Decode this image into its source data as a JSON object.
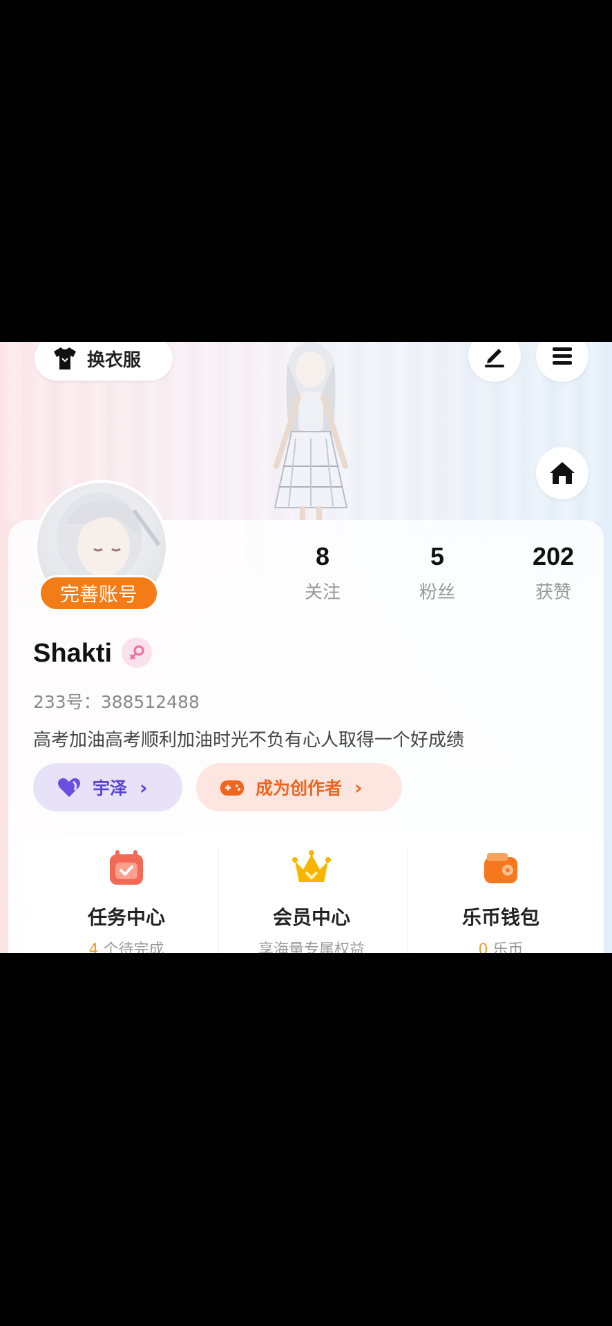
{
  "header": {
    "outfit_label": "换衣服",
    "icons": [
      "tshirt-icon",
      "edit-icon",
      "menu-icon",
      "home-icon"
    ]
  },
  "profile": {
    "complete_label": "完善账号",
    "username": "Shakti",
    "uid_label": "233号：",
    "uid": "388512488",
    "bio": "高考加油高考顺利加油时光不负有心人取得一个好成绩"
  },
  "stats": [
    {
      "value": "8",
      "label": "关注"
    },
    {
      "value": "5",
      "label": "粉丝"
    },
    {
      "value": "202",
      "label": "获赞"
    }
  ],
  "tags": {
    "friend": "宇泽",
    "creator": "成为创作者"
  },
  "quick": {
    "task": {
      "title": "任务中心",
      "count": "4",
      "suffix": " 个待完成"
    },
    "vip": {
      "title": "会员中心",
      "subtitle": "享海量专属权益"
    },
    "wallet": {
      "title": "乐币钱包",
      "count": "0",
      "suffix": " 乐币"
    }
  },
  "colors": {
    "accent_orange": "#f47c17",
    "friend_purple": "#5a45d6",
    "creator_orange": "#f0641e"
  }
}
